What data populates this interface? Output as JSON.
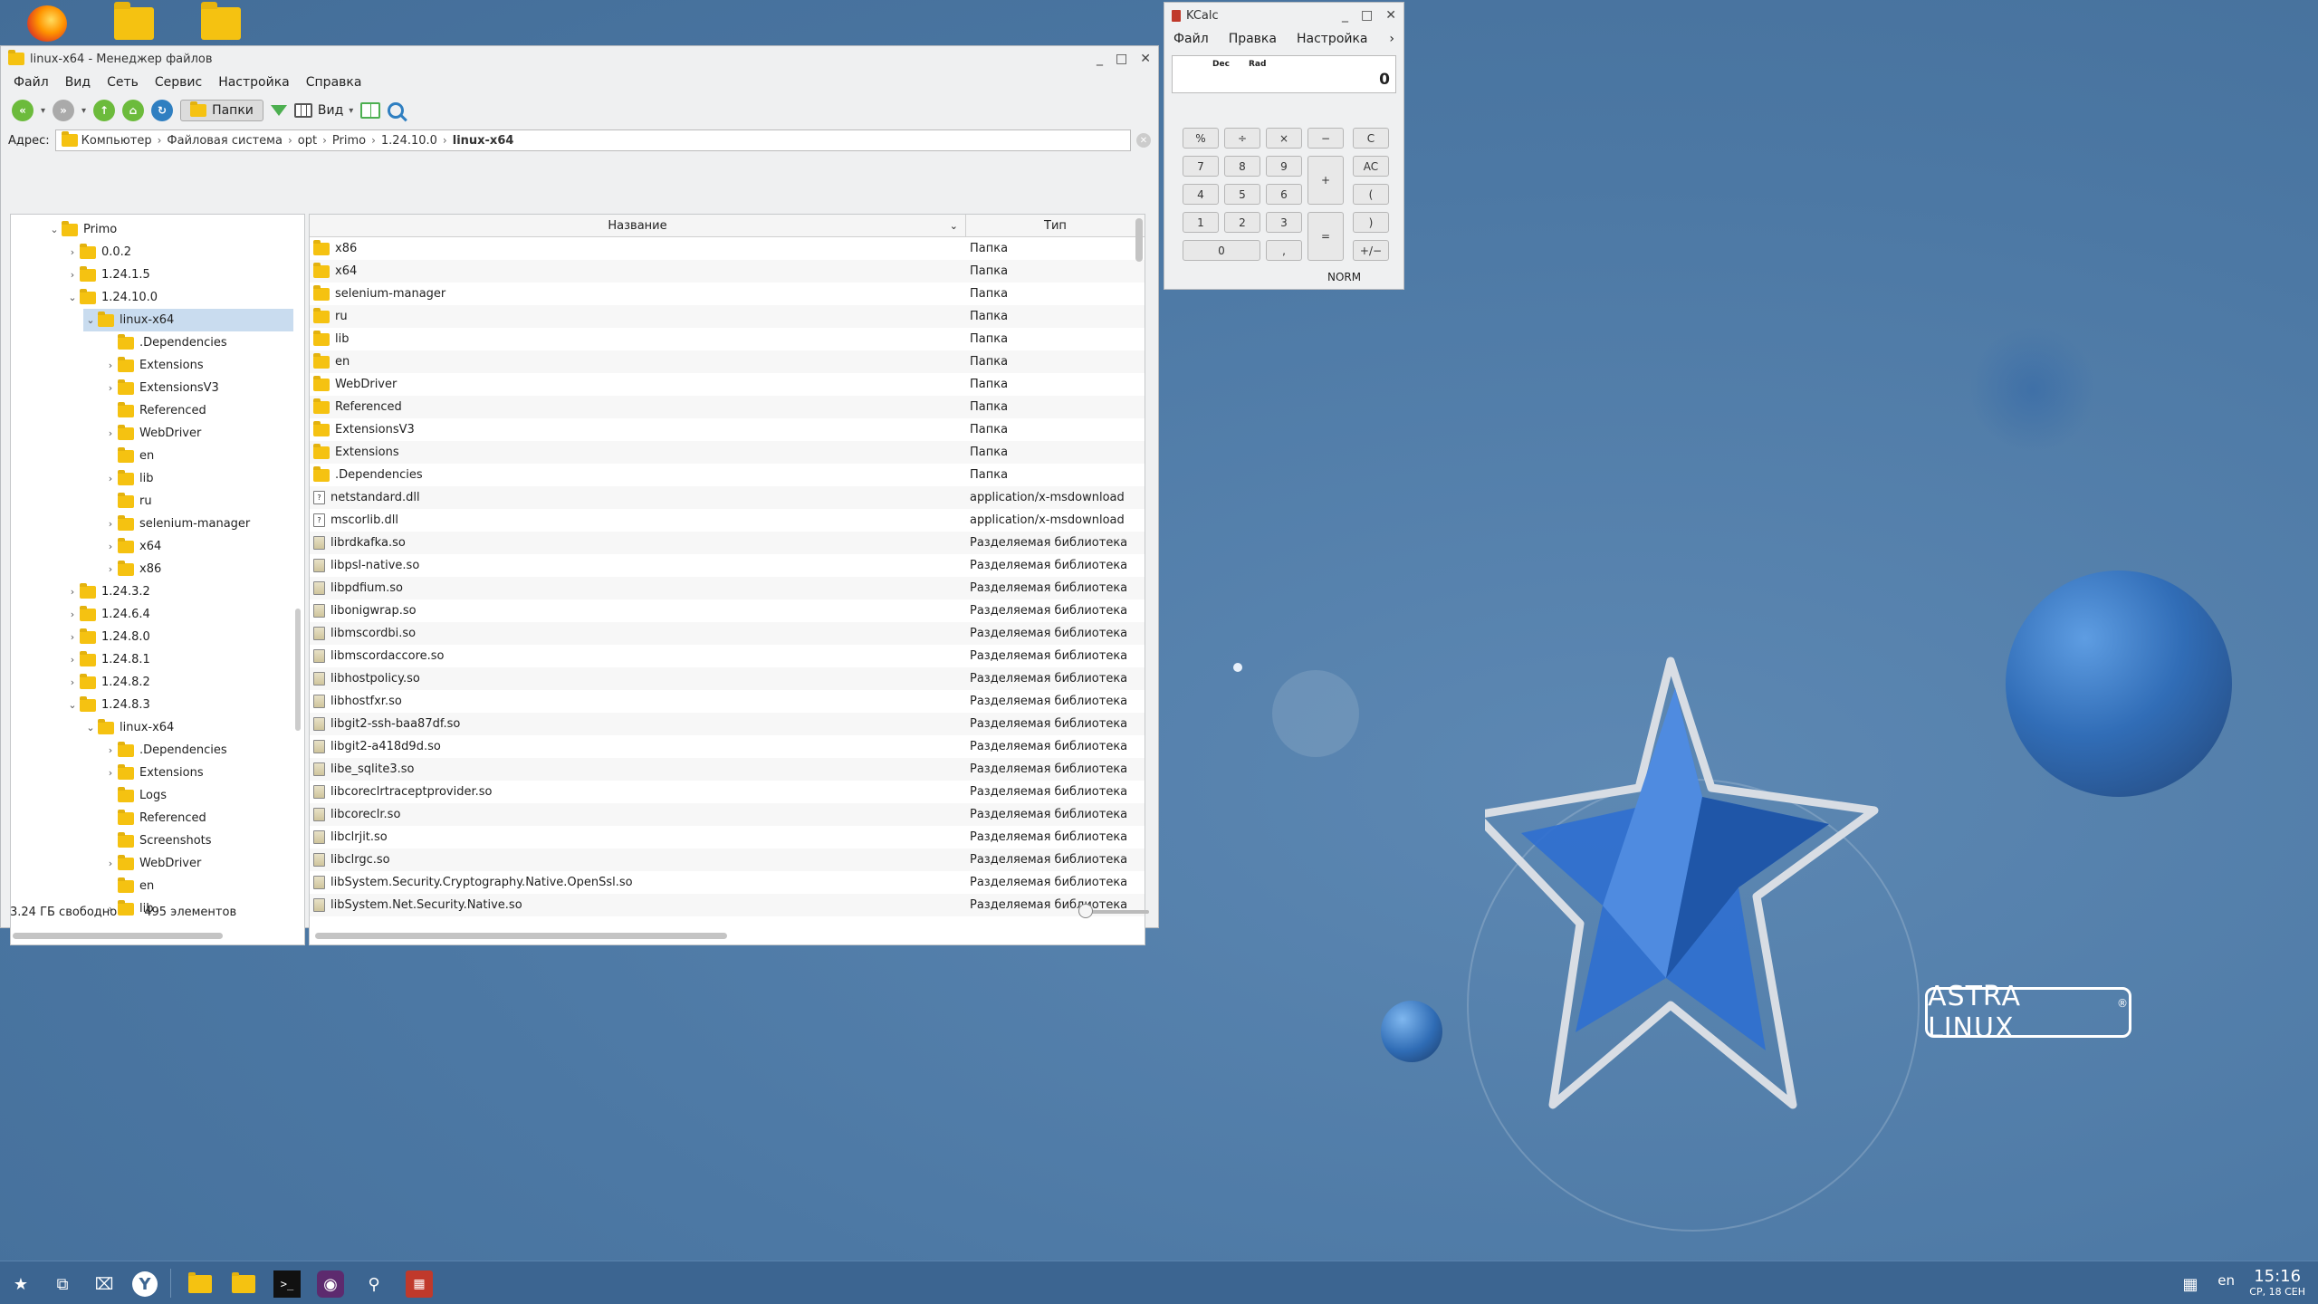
{
  "desktop": {
    "brand": "ASTRA LINUX",
    "brand_mark": "®"
  },
  "filemanager": {
    "title": "linux-x64 - Менеджер файлов",
    "menu": [
      "Файл",
      "Вид",
      "Сеть",
      "Сервис",
      "Настройка",
      "Справка"
    ],
    "toolbar": {
      "folders_label": "Папки",
      "view_label": "Вид"
    },
    "address": {
      "label": "Адрес:",
      "crumbs": [
        "Компьютер",
        "Файловая система",
        "opt",
        "Primo",
        "1.24.10.0",
        "linux-x64"
      ]
    },
    "tree": [
      {
        "label": "Primo",
        "depth": 1,
        "arrow": "v"
      },
      {
        "label": "0.0.2",
        "depth": 2,
        "arrow": ">"
      },
      {
        "label": "1.24.1.5",
        "depth": 2,
        "arrow": ">"
      },
      {
        "label": "1.24.10.0",
        "depth": 2,
        "arrow": "v"
      },
      {
        "label": "linux-x64",
        "depth": 3,
        "arrow": "v",
        "selected": true
      },
      {
        "label": ".Dependencies",
        "depth": 4,
        "arrow": ""
      },
      {
        "label": "Extensions",
        "depth": 4,
        "arrow": ">"
      },
      {
        "label": "ExtensionsV3",
        "depth": 4,
        "arrow": ">"
      },
      {
        "label": "Referenced",
        "depth": 4,
        "arrow": ""
      },
      {
        "label": "WebDriver",
        "depth": 4,
        "arrow": ">"
      },
      {
        "label": "en",
        "depth": 4,
        "arrow": ""
      },
      {
        "label": "lib",
        "depth": 4,
        "arrow": ">"
      },
      {
        "label": "ru",
        "depth": 4,
        "arrow": ""
      },
      {
        "label": "selenium-manager",
        "depth": 4,
        "arrow": ">"
      },
      {
        "label": "x64",
        "depth": 4,
        "arrow": ">"
      },
      {
        "label": "x86",
        "depth": 4,
        "arrow": ">"
      },
      {
        "label": "1.24.3.2",
        "depth": 2,
        "arrow": ">"
      },
      {
        "label": "1.24.6.4",
        "depth": 2,
        "arrow": ">"
      },
      {
        "label": "1.24.8.0",
        "depth": 2,
        "arrow": ">"
      },
      {
        "label": "1.24.8.1",
        "depth": 2,
        "arrow": ">"
      },
      {
        "label": "1.24.8.2",
        "depth": 2,
        "arrow": ">"
      },
      {
        "label": "1.24.8.3",
        "depth": 2,
        "arrow": "v"
      },
      {
        "label": "linux-x64",
        "depth": 3,
        "arrow": "v"
      },
      {
        "label": ".Dependencies",
        "depth": 4,
        "arrow": ">"
      },
      {
        "label": "Extensions",
        "depth": 4,
        "arrow": ">"
      },
      {
        "label": "Logs",
        "depth": 4,
        "arrow": ""
      },
      {
        "label": "Referenced",
        "depth": 4,
        "arrow": ""
      },
      {
        "label": "Screenshots",
        "depth": 4,
        "arrow": ""
      },
      {
        "label": "WebDriver",
        "depth": 4,
        "arrow": ">"
      },
      {
        "label": "en",
        "depth": 4,
        "arrow": ""
      },
      {
        "label": "lib",
        "depth": 4,
        "arrow": ">"
      }
    ],
    "columns": {
      "name": "Название",
      "type": "Тип"
    },
    "files": [
      {
        "name": "x86",
        "type": "Папка",
        "kind": "folder"
      },
      {
        "name": "x64",
        "type": "Папка",
        "kind": "folder"
      },
      {
        "name": "selenium-manager",
        "type": "Папка",
        "kind": "folder"
      },
      {
        "name": "ru",
        "type": "Папка",
        "kind": "folder"
      },
      {
        "name": "lib",
        "type": "Папка",
        "kind": "folder"
      },
      {
        "name": "en",
        "type": "Папка",
        "kind": "folder"
      },
      {
        "name": "WebDriver",
        "type": "Папка",
        "kind": "folder"
      },
      {
        "name": "Referenced",
        "type": "Папка",
        "kind": "folder"
      },
      {
        "name": "ExtensionsV3",
        "type": "Папка",
        "kind": "folder"
      },
      {
        "name": "Extensions",
        "type": "Папка",
        "kind": "folder"
      },
      {
        "name": ".Dependencies",
        "type": "Папка",
        "kind": "folder"
      },
      {
        "name": "netstandard.dll",
        "type": "application/x-msdownload",
        "kind": "file"
      },
      {
        "name": "mscorlib.dll",
        "type": "application/x-msdownload",
        "kind": "file"
      },
      {
        "name": "librdkafka.so",
        "type": "Разделяемая библиотека",
        "kind": "lib"
      },
      {
        "name": "libpsl-native.so",
        "type": "Разделяемая библиотека",
        "kind": "lib"
      },
      {
        "name": "libpdfium.so",
        "type": "Разделяемая библиотека",
        "kind": "lib"
      },
      {
        "name": "libonigwrap.so",
        "type": "Разделяемая библиотека",
        "kind": "lib"
      },
      {
        "name": "libmscordbi.so",
        "type": "Разделяемая библиотека",
        "kind": "lib"
      },
      {
        "name": "libmscordaccore.so",
        "type": "Разделяемая библиотека",
        "kind": "lib"
      },
      {
        "name": "libhostpolicy.so",
        "type": "Разделяемая библиотека",
        "kind": "lib"
      },
      {
        "name": "libhostfxr.so",
        "type": "Разделяемая библиотека",
        "kind": "lib"
      },
      {
        "name": "libgit2-ssh-baa87df.so",
        "type": "Разделяемая библиотека",
        "kind": "lib"
      },
      {
        "name": "libgit2-a418d9d.so",
        "type": "Разделяемая библиотека",
        "kind": "lib"
      },
      {
        "name": "libe_sqlite3.so",
        "type": "Разделяемая библиотека",
        "kind": "lib"
      },
      {
        "name": "libcoreclrtraceptprovider.so",
        "type": "Разделяемая библиотека",
        "kind": "lib"
      },
      {
        "name": "libcoreclr.so",
        "type": "Разделяемая библиотека",
        "kind": "lib"
      },
      {
        "name": "libclrjit.so",
        "type": "Разделяемая библиотека",
        "kind": "lib"
      },
      {
        "name": "libclrgc.so",
        "type": "Разделяемая библиотека",
        "kind": "lib"
      },
      {
        "name": "libSystem.Security.Cryptography.Native.OpenSsl.so",
        "type": "Разделяемая библиотека",
        "kind": "lib"
      },
      {
        "name": "libSystem.Net.Security.Native.so",
        "type": "Разделяемая библиотека",
        "kind": "lib"
      }
    ],
    "status": {
      "free": "3.24 ГБ свободно",
      "count": "495 элементов"
    }
  },
  "kcalc": {
    "title": "KCalc",
    "menu": [
      "Файл",
      "Правка",
      "Настройка"
    ],
    "mode_dec": "Dec",
    "mode_rad": "Rad",
    "display": "0",
    "status": "NORM",
    "buttons": {
      "percent": "%",
      "divide": "÷",
      "multiply": "×",
      "minus": "−",
      "clear": "C",
      "n7": "7",
      "n8": "8",
      "n9": "9",
      "plus": "+",
      "allclear": "AC",
      "n4": "4",
      "n5": "5",
      "n6": "6",
      "lparen": "(",
      "n1": "1",
      "n2": "2",
      "n3": "3",
      "equals": "=",
      "rparen": ")",
      "n0": "0",
      "comma": ",",
      "sign": "+/−"
    }
  },
  "taskbar": {
    "lang": "en",
    "time": "15:16",
    "date": "СР, 18 СЕН"
  }
}
